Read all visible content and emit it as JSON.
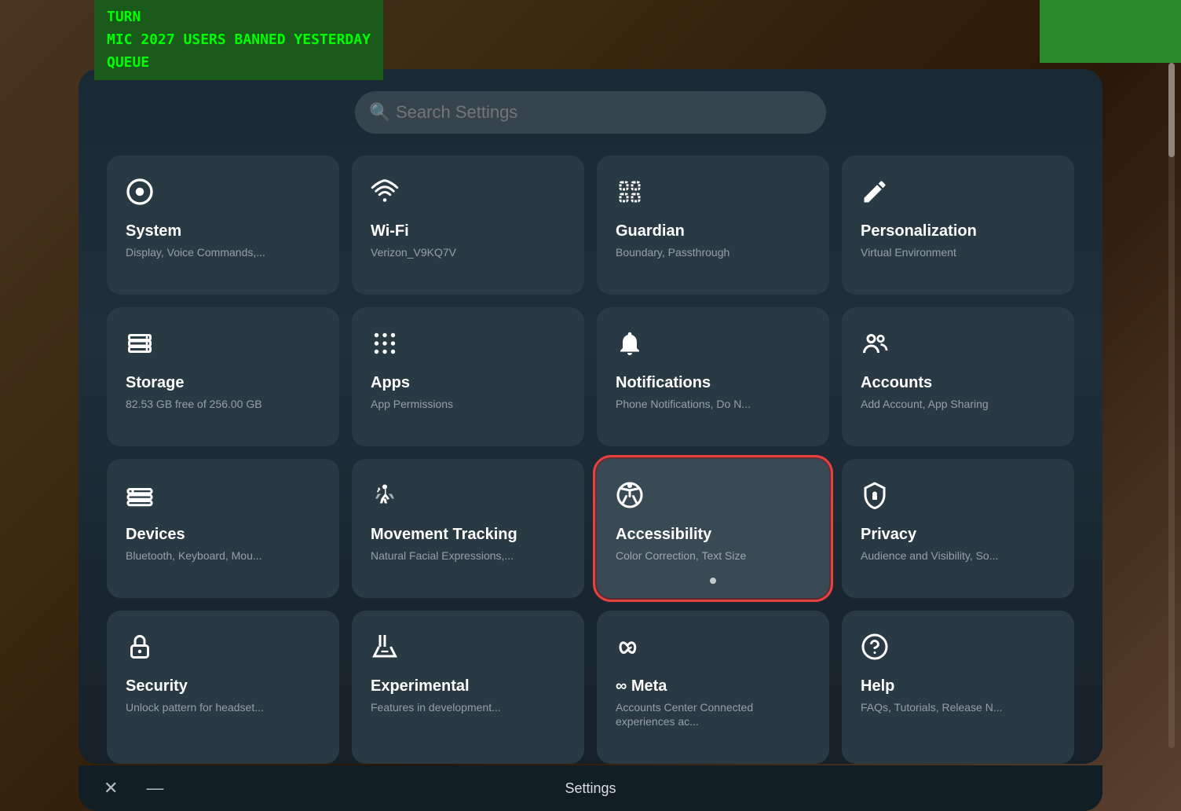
{
  "terminal": {
    "line1": "TURN",
    "line2": "MIC    2027 USERS BANNED YESTERDAY",
    "line3": "QUEUE"
  },
  "search": {
    "placeholder": "Search Settings"
  },
  "bottom_bar": {
    "title": "Settings",
    "close_label": "✕",
    "minimize_label": "—"
  },
  "tiles": [
    {
      "id": "system",
      "title": "System",
      "subtitle": "Display, Voice Commands,...",
      "icon": "system",
      "highlighted": false
    },
    {
      "id": "wifi",
      "title": "Wi-Fi",
      "subtitle": "Verizon_V9KQ7V",
      "icon": "wifi",
      "highlighted": false
    },
    {
      "id": "guardian",
      "title": "Guardian",
      "subtitle": "Boundary, Passthrough",
      "icon": "guardian",
      "highlighted": false
    },
    {
      "id": "personalization",
      "title": "Personalization",
      "subtitle": "Virtual Environment",
      "icon": "personalization",
      "highlighted": false
    },
    {
      "id": "storage",
      "title": "Storage",
      "subtitle": "82.53 GB free of 256.00 GB",
      "icon": "storage",
      "highlighted": false
    },
    {
      "id": "apps",
      "title": "Apps",
      "subtitle": "App Permissions",
      "icon": "apps",
      "highlighted": false
    },
    {
      "id": "notifications",
      "title": "Notifications",
      "subtitle": "Phone Notifications, Do N...",
      "icon": "notifications",
      "highlighted": false
    },
    {
      "id": "accounts",
      "title": "Accounts",
      "subtitle": "Add Account, App Sharing",
      "icon": "accounts",
      "highlighted": false
    },
    {
      "id": "devices",
      "title": "Devices",
      "subtitle": "Bluetooth, Keyboard, Mou...",
      "icon": "devices",
      "highlighted": false
    },
    {
      "id": "movement",
      "title": "Movement Tracking",
      "subtitle": "Natural Facial Expressions,...",
      "icon": "movement",
      "highlighted": false
    },
    {
      "id": "accessibility",
      "title": "Accessibility",
      "subtitle": "Color Correction, Text Size",
      "icon": "accessibility",
      "highlighted": true
    },
    {
      "id": "privacy",
      "title": "Privacy",
      "subtitle": "Audience and Visibility, So...",
      "icon": "privacy",
      "highlighted": false
    },
    {
      "id": "security",
      "title": "Security",
      "subtitle": "Unlock pattern for headset...",
      "icon": "security",
      "highlighted": false
    },
    {
      "id": "experimental",
      "title": "Experimental",
      "subtitle": "Features in development...",
      "icon": "experimental",
      "highlighted": false
    },
    {
      "id": "meta",
      "title": "∞ Meta",
      "subtitle": "Accounts Center\nConnected experiences ac...",
      "icon": "meta",
      "highlighted": false
    },
    {
      "id": "help",
      "title": "Help",
      "subtitle": "FAQs, Tutorials, Release N...",
      "icon": "help",
      "highlighted": false
    }
  ]
}
